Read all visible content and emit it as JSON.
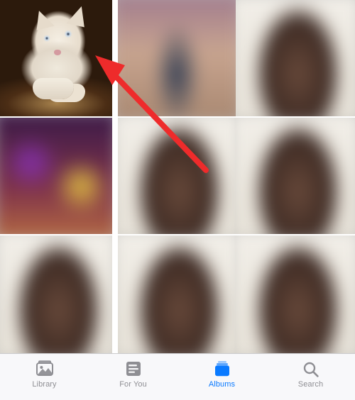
{
  "palette": {
    "tab_active": "#0a7aff",
    "tab_inactive": "#8e8e93",
    "arrow": "#ee2b2b"
  },
  "annotation": {
    "arrow_target": "top-left-thumbnail"
  },
  "grid": {
    "items": [
      {
        "row": 1,
        "col": 1,
        "kind": "kitten",
        "blurred": false
      },
      {
        "row": 1,
        "col": 2,
        "kind": "dusk",
        "blurred": true
      },
      {
        "row": 1,
        "col": 3,
        "kind": "subject",
        "blurred": true
      },
      {
        "row": 2,
        "col": 1,
        "kind": "disco",
        "blurred": true
      },
      {
        "row": 2,
        "col": 2,
        "kind": "subject",
        "blurred": true
      },
      {
        "row": 2,
        "col": 3,
        "kind": "subject",
        "blurred": true
      },
      {
        "row": 3,
        "col": 1,
        "kind": "subject",
        "blurred": true
      },
      {
        "row": 3,
        "col": 2,
        "kind": "subject",
        "blurred": true
      },
      {
        "row": 3,
        "col": 3,
        "kind": "subject",
        "blurred": true
      }
    ]
  },
  "tabbar": {
    "active": "albums",
    "items": [
      {
        "id": "library",
        "label": "Library",
        "icon": "library-icon"
      },
      {
        "id": "foryou",
        "label": "For You",
        "icon": "for-you-icon"
      },
      {
        "id": "albums",
        "label": "Albums",
        "icon": "albums-icon"
      },
      {
        "id": "search",
        "label": "Search",
        "icon": "search-icon"
      }
    ]
  }
}
